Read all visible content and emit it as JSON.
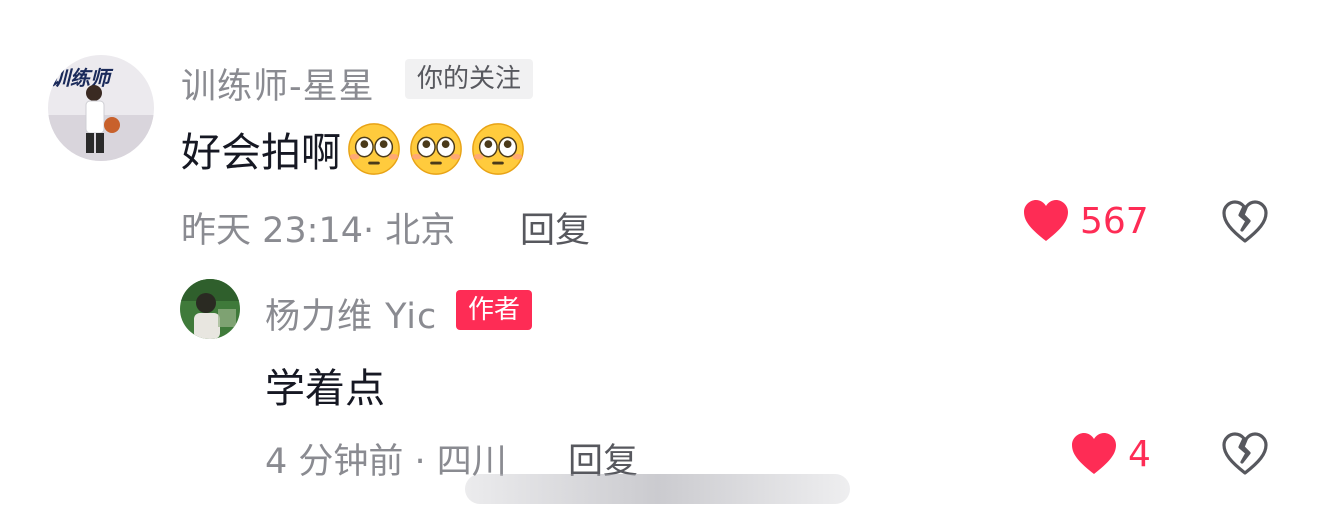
{
  "comments": [
    {
      "username": "训练师-星星",
      "badge": "你的关注",
      "text": "好会拍啊",
      "emojis": [
        "flushed-pleading-emoji",
        "flushed-pleading-emoji",
        "flushed-pleading-emoji"
      ],
      "meta": "昨天 23:14· 北京",
      "reply_label": "回复",
      "like_count": "567",
      "liked": true,
      "avatar_text": "训练师",
      "avatar_colors": {
        "bg": "#e8e6ea",
        "text": "#1a2a5a"
      }
    },
    {
      "username": "杨力维 Yic",
      "badge": "作者",
      "text": "学着点",
      "emojis": [],
      "meta": "4 分钟前 · 四川",
      "reply_label": "回复",
      "like_count": "4",
      "liked": true,
      "avatar_colors": {
        "bg": "#3f7a3a",
        "text": "#ffffff"
      }
    }
  ],
  "colors": {
    "accent": "#fe2c55",
    "muted": "#8a8b91",
    "text": "#161823"
  },
  "icons": {
    "like": "heart-filled-icon",
    "dislike": "broken-heart-icon"
  }
}
